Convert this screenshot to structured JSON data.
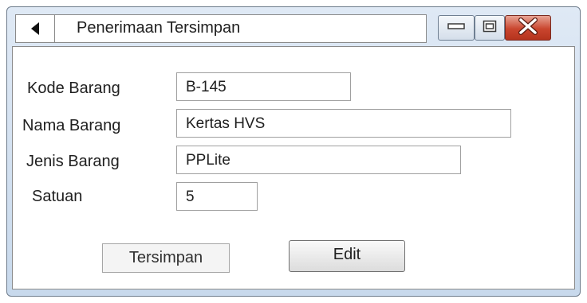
{
  "window": {
    "title": "Penerimaan Tersimpan"
  },
  "icons": {
    "back": "triangle-left-icon",
    "minimize": "minimize-icon",
    "maximize": "maximize-icon",
    "close": "close-icon"
  },
  "form": {
    "kode_barang": {
      "label": "Kode Barang",
      "value": "B-145"
    },
    "nama_barang": {
      "label": "Nama Barang",
      "value": "Kertas HVS"
    },
    "jenis_barang": {
      "label": "Jenis Barang",
      "value": "PPLite"
    },
    "satuan": {
      "label": "Satuan",
      "value": "5"
    }
  },
  "buttons": {
    "tersimpan": "Tersimpan",
    "edit": "Edit"
  },
  "colors": {
    "frame": "#c8d9ec",
    "close_button": "#c9452e"
  }
}
